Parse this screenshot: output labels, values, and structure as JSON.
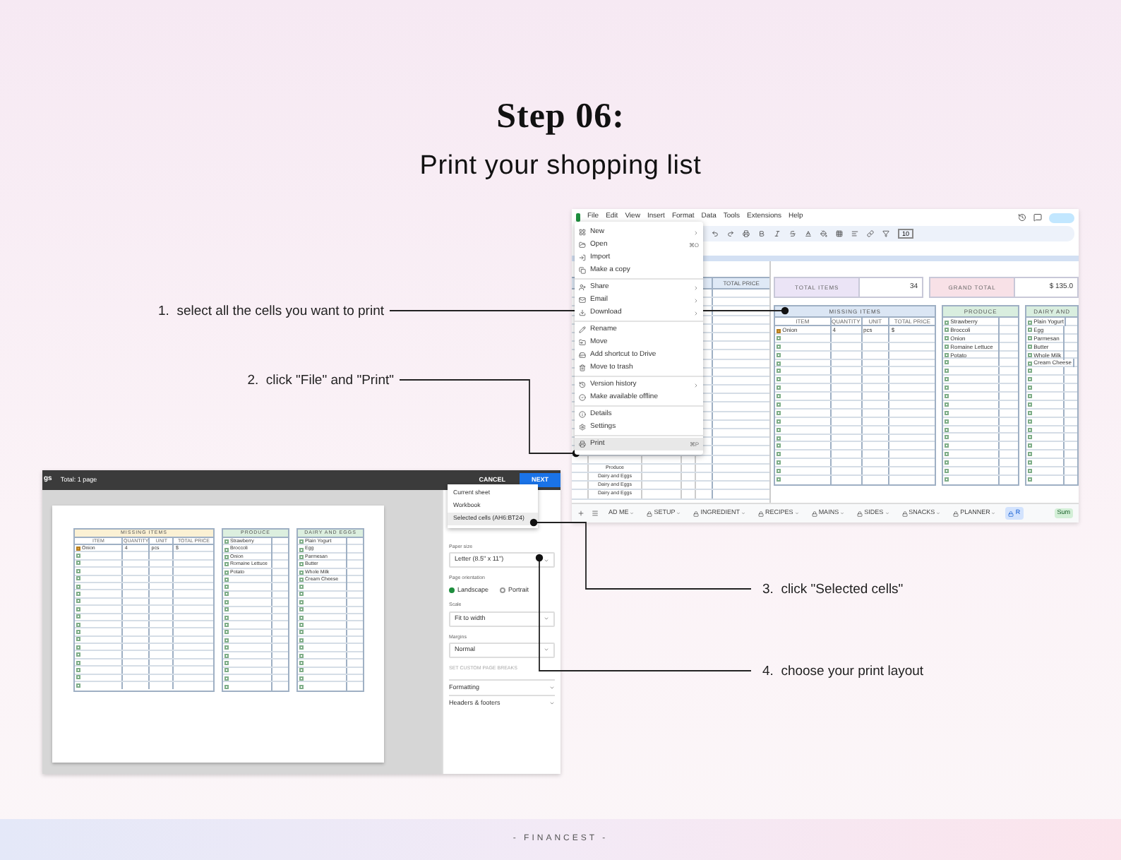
{
  "title": "Step 06:",
  "subtitle": "Print your shopping list",
  "callouts": [
    {
      "text": "1.  select all the cells you want to print"
    },
    {
      "text": "2.  click \"File\" and \"Print\""
    },
    {
      "text": "3.  click \"Selected cells\""
    },
    {
      "text": "4.  choose your print layout"
    }
  ],
  "spreadsheet": {
    "menu_bar": [
      "File",
      "Edit",
      "View",
      "Insert",
      "Format",
      "Data",
      "Tools",
      "Extensions",
      "Help"
    ],
    "font_size": "10",
    "file_menu": [
      [
        {
          "label": "New",
          "submenu": true,
          "selected": false
        },
        {
          "label": "Open",
          "shortcut": "⌘O",
          "submenu": false,
          "selected": false
        },
        {
          "label": "Import",
          "submenu": false,
          "selected": false
        },
        {
          "label": "Make a copy",
          "submenu": false,
          "selected": false
        }
      ],
      [
        {
          "label": "Share",
          "submenu": true,
          "selected": false
        },
        {
          "label": "Email",
          "submenu": true,
          "selected": false
        },
        {
          "label": "Download",
          "submenu": true,
          "selected": false
        }
      ],
      [
        {
          "label": "Rename",
          "submenu": false,
          "selected": false
        },
        {
          "label": "Move",
          "submenu": false,
          "selected": false
        },
        {
          "label": "Add shortcut to Drive",
          "submenu": false,
          "selected": false
        },
        {
          "label": "Move to trash",
          "submenu": false,
          "selected": false
        }
      ],
      [
        {
          "label": "Version history",
          "submenu": true,
          "selected": false
        },
        {
          "label": "Make available offline",
          "submenu": false,
          "selected": false
        }
      ],
      [
        {
          "label": "Details",
          "submenu": false,
          "selected": false
        },
        {
          "label": "Settings",
          "submenu": false,
          "selected": false
        }
      ],
      [
        {
          "label": "Print",
          "shortcut": "⌘P",
          "submenu": false,
          "selected": true
        }
      ]
    ],
    "left_column": {
      "header": "TOTAL PRICE",
      "rows": [
        "Produce",
        "Dairy and Eggs",
        "Dairy and Eggs",
        "Dairy and Eggs"
      ]
    },
    "summary": [
      {
        "label": "TOTAL ITEMS",
        "value": "34",
        "color": "#ebe4f6"
      },
      {
        "label": "GRAND TOTAL",
        "value": "$ 135.0",
        "color": "#f8e1e7"
      }
    ],
    "tables": [
      {
        "kind": "priced",
        "title": "MISSING ITEMS",
        "color": "#dbe6f4",
        "columns": [
          "ITEM",
          "QUANTITY",
          "UNIT",
          "TOTAL PRICE"
        ],
        "rows": [
          {
            "checked": true,
            "cells": [
              "Onion",
              "4",
              "pcs",
              "$"
            ]
          },
          {
            "checked": false
          },
          {
            "checked": false
          },
          {
            "checked": false
          },
          {
            "checked": false
          },
          {
            "checked": false
          },
          {
            "checked": false
          },
          {
            "checked": false
          },
          {
            "checked": false
          },
          {
            "checked": false
          },
          {
            "checked": false
          },
          {
            "checked": false
          },
          {
            "checked": false
          },
          {
            "checked": false
          },
          {
            "checked": false
          },
          {
            "checked": false
          },
          {
            "checked": false
          },
          {
            "checked": false
          },
          {
            "checked": false
          }
        ]
      },
      {
        "kind": "simple",
        "title": "PRODUCE",
        "color": "#d9eedf",
        "rows": [
          {
            "checked": false,
            "cells": [
              "Strawberry"
            ]
          },
          {
            "checked": false,
            "cells": [
              "Broccoli"
            ]
          },
          {
            "checked": false,
            "cells": [
              "Onion"
            ]
          },
          {
            "checked": false,
            "cells": [
              "Romaine Lettuce"
            ]
          },
          {
            "checked": false,
            "cells": [
              "Potato"
            ]
          },
          {
            "checked": false
          },
          {
            "checked": false
          },
          {
            "checked": false
          },
          {
            "checked": false
          },
          {
            "checked": false
          },
          {
            "checked": false
          },
          {
            "checked": false
          },
          {
            "checked": false
          },
          {
            "checked": false
          },
          {
            "checked": false
          },
          {
            "checked": false
          },
          {
            "checked": false
          },
          {
            "checked": false
          },
          {
            "checked": false
          },
          {
            "checked": false
          }
        ]
      },
      {
        "kind": "simple",
        "title": "DAIRY AND",
        "color": "#d9eedf",
        "rows": [
          {
            "checked": false,
            "cells": [
              "Plain Yogurt"
            ]
          },
          {
            "checked": false,
            "cells": [
              "Egg"
            ]
          },
          {
            "checked": false,
            "cells": [
              "Parmesan"
            ]
          },
          {
            "checked": false,
            "cells": [
              "Butter"
            ]
          },
          {
            "checked": false,
            "cells": [
              "Whole Milk"
            ]
          },
          {
            "checked": false,
            "cells": [
              "Cream Cheese"
            ]
          },
          {
            "checked": false
          },
          {
            "checked": false
          },
          {
            "checked": false
          },
          {
            "checked": false
          },
          {
            "checked": false
          },
          {
            "checked": false
          },
          {
            "checked": false
          },
          {
            "checked": false
          },
          {
            "checked": false
          },
          {
            "checked": false
          },
          {
            "checked": false
          },
          {
            "checked": false
          },
          {
            "checked": false
          },
          {
            "checked": false
          }
        ]
      }
    ],
    "sheet_tabs": [
      {
        "label": "AD ME",
        "locked": false,
        "selected": false
      },
      {
        "label": "SETUP",
        "locked": true,
        "selected": false
      },
      {
        "label": "INGREDIENT",
        "locked": true,
        "selected": false
      },
      {
        "label": "RECIPES",
        "locked": true,
        "selected": false
      },
      {
        "label": "MAINS",
        "locked": true,
        "selected": false
      },
      {
        "label": "SIDES",
        "locked": true,
        "selected": false
      },
      {
        "label": "SNACKS",
        "locked": true,
        "selected": false
      },
      {
        "label": "PLANNER",
        "locked": true,
        "selected": false
      },
      {
        "label": "R",
        "locked": true,
        "selected": true
      }
    ],
    "sum_label": "Sum"
  },
  "print_dialog": {
    "title": "gs",
    "pages": "Total: 1 page",
    "cancel": "CANCEL",
    "next": "NEXT",
    "range_options": [
      {
        "label": "Current sheet",
        "selected": false
      },
      {
        "label": "Workbook",
        "selected": false
      },
      {
        "label": "Selected cells (AH6:BT24)",
        "selected": true
      }
    ],
    "paper_size": {
      "label": "Paper size",
      "value": "Letter (8.5\" x 11\")"
    },
    "orientation": {
      "label": "Page orientation",
      "options": [
        {
          "label": "Landscape",
          "selected": true
        },
        {
          "label": "Portrait",
          "selected": false
        }
      ]
    },
    "scale": {
      "label": "Scale",
      "value": "Fit to width"
    },
    "margins": {
      "label": "Margins",
      "value": "Normal"
    },
    "page_breaks": "SET CUSTOM PAGE BREAKS",
    "sections": [
      "Formatting",
      "Headers & footers"
    ],
    "preview_tables": [
      {
        "kind": "priced",
        "title": "MISSING ITEMS",
        "color": "#fbf1d4",
        "columns": [
          "ITEM",
          "QUANTITY",
          "UNIT",
          "TOTAL PRICE"
        ],
        "rows": [
          {
            "checked": true,
            "cells": [
              "Onion",
              "4",
              "pcs",
              "$"
            ]
          },
          {
            "checked": false
          },
          {
            "checked": false
          },
          {
            "checked": false
          },
          {
            "checked": false
          },
          {
            "checked": false
          },
          {
            "checked": false
          },
          {
            "checked": false
          },
          {
            "checked": false
          },
          {
            "checked": false
          },
          {
            "checked": false
          },
          {
            "checked": false
          },
          {
            "checked": false
          },
          {
            "checked": false
          },
          {
            "checked": false
          },
          {
            "checked": false
          },
          {
            "checked": false
          },
          {
            "checked": false
          },
          {
            "checked": false
          }
        ]
      },
      {
        "kind": "simple",
        "title": "PRODUCE",
        "color": "#dcefdf",
        "rows": [
          {
            "checked": false,
            "cells": [
              "Strawberry"
            ]
          },
          {
            "checked": false,
            "cells": [
              "Broccoli"
            ]
          },
          {
            "checked": false,
            "cells": [
              "Onion"
            ]
          },
          {
            "checked": false,
            "cells": [
              "Romaine Lettuce"
            ]
          },
          {
            "checked": false,
            "cells": [
              "Potato"
            ]
          },
          {
            "checked": false
          },
          {
            "checked": false
          },
          {
            "checked": false
          },
          {
            "checked": false
          },
          {
            "checked": false
          },
          {
            "checked": false
          },
          {
            "checked": false
          },
          {
            "checked": false
          },
          {
            "checked": false
          },
          {
            "checked": false
          },
          {
            "checked": false
          },
          {
            "checked": false
          },
          {
            "checked": false
          },
          {
            "checked": false
          },
          {
            "checked": false
          }
        ]
      },
      {
        "kind": "simple",
        "title": "DAIRY AND EGGS",
        "color": "#dcefdf",
        "rows": [
          {
            "checked": false,
            "cells": [
              "Plain Yogurt"
            ]
          },
          {
            "checked": false,
            "cells": [
              "Egg"
            ]
          },
          {
            "checked": false,
            "cells": [
              "Parmesan"
            ]
          },
          {
            "checked": false,
            "cells": [
              "Butter"
            ]
          },
          {
            "checked": false,
            "cells": [
              "Whole Milk"
            ]
          },
          {
            "checked": false,
            "cells": [
              "Cream Cheese"
            ]
          },
          {
            "checked": false
          },
          {
            "checked": false
          },
          {
            "checked": false
          },
          {
            "checked": false
          },
          {
            "checked": false
          },
          {
            "checked": false
          },
          {
            "checked": false
          },
          {
            "checked": false
          },
          {
            "checked": false
          },
          {
            "checked": false
          },
          {
            "checked": false
          },
          {
            "checked": false
          },
          {
            "checked": false
          },
          {
            "checked": false
          }
        ]
      }
    ]
  },
  "footer": "- FINANCEST -"
}
